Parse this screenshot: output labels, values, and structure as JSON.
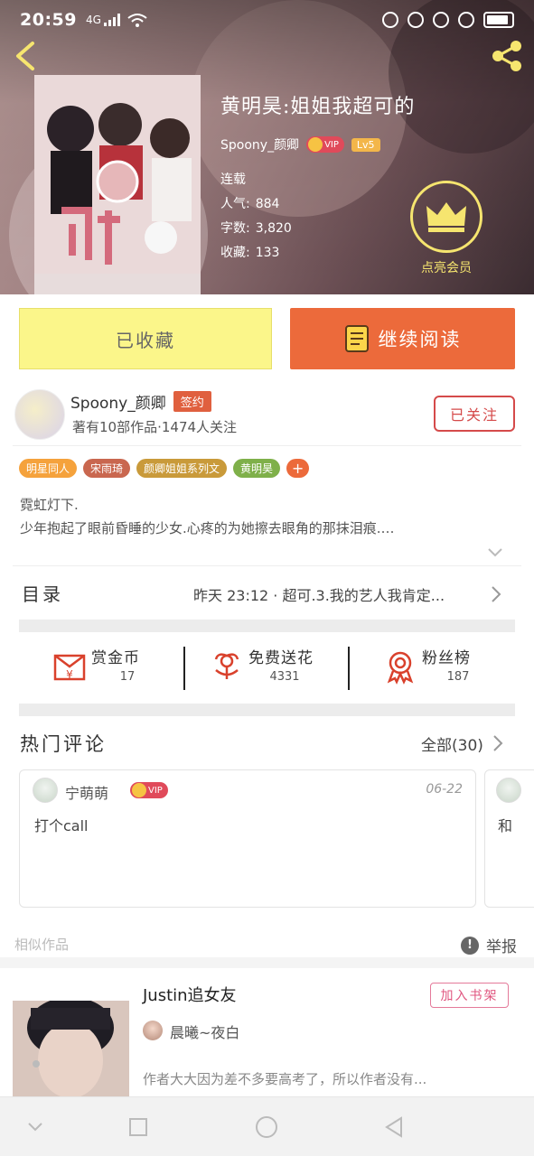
{
  "status_bar": {
    "time": "20:59",
    "signal": "4G"
  },
  "book": {
    "title": "黄明昊:姐姐我超可的",
    "author": "Spoony_颜卿",
    "vip_label": "VIP",
    "level": "Lv5",
    "status": "连载",
    "popularity_label": "人气:",
    "popularity": "884",
    "words_label": "字数:",
    "words": "3,820",
    "collections_label": "收藏:",
    "collections": "133"
  },
  "vip_member": {
    "label": "点亮会员"
  },
  "actions": {
    "collected": "已收藏",
    "continue": "继续阅读"
  },
  "author_bar": {
    "name": "Spoony_颜卿",
    "sign_badge": "签约",
    "desc": "著有10部作品·1474人关注",
    "follow": "已关注"
  },
  "tags": [
    {
      "label": "明星同人",
      "color": "#f5a23c"
    },
    {
      "label": "宋雨琦",
      "color": "#c9674f"
    },
    {
      "label": "颜卿姐姐系列文",
      "color": "#c99a3a"
    },
    {
      "label": "黄明昊",
      "color": "#7fb04a"
    }
  ],
  "tag_more": "+",
  "intro": {
    "line1": "霓虹灯下.",
    "line2": "少年抱起了眼前昏睡的少女.心疼的为她擦去眼角的那抹泪痕.…"
  },
  "toc": {
    "label": "目录",
    "latest": "昨天 23:12 · 超可.3.我的艺人我肯定..."
  },
  "rewards": [
    {
      "title": "赏金币",
      "count": "17",
      "icon": "coin-envelope-icon"
    },
    {
      "title": "免费送花",
      "count": "4331",
      "icon": "flower-icon"
    },
    {
      "title": "粉丝榜",
      "count": "187",
      "icon": "medal-icon"
    }
  ],
  "hot_comments": {
    "title": "热门评论",
    "all": "全部(30)",
    "items": [
      {
        "user": "宁萌萌",
        "vip": "VIP",
        "date": "06-22",
        "text": "打个call"
      },
      {
        "user": "",
        "vip": "",
        "date": "",
        "text": "和"
      }
    ]
  },
  "similar": {
    "label": "相似作品",
    "report": "举报"
  },
  "recommendation": {
    "title": "Justin追女友",
    "add": "加入书架",
    "author": "晨曦~夜白",
    "desc": "作者大大因为差不多要高考了，所以作者没有..."
  },
  "colors": {
    "accent": "#ec6a3b",
    "collected_bg": "#fbf68a",
    "follow": "#d54a4a",
    "vip_gold": "#f6e56f"
  }
}
